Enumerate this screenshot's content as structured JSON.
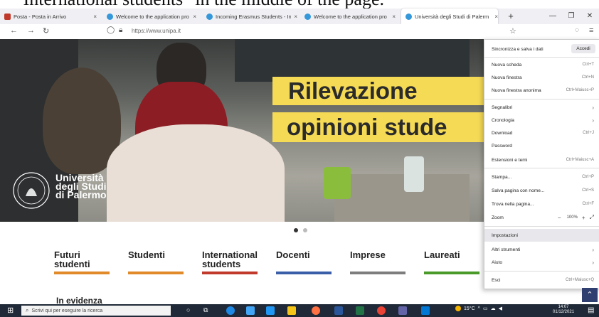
{
  "caption": "\"International students\" in the middle of the page.",
  "browser": {
    "tabs": [
      {
        "title": "Posta - Posta in Arrivo",
        "favicon_color": "#c0392b"
      },
      {
        "title": "Welcome to the application pro",
        "favicon_color": "#3498db"
      },
      {
        "title": "Incoming Erasmus Students - In",
        "favicon_color": "#3498db"
      },
      {
        "title": "Welcome to the application pro",
        "favicon_color": "#3498db"
      },
      {
        "title": "Università degli Studi di Palerm",
        "favicon_color": "#3498db"
      }
    ],
    "new_tab": "+",
    "close_glyph": "×",
    "url": "https://www.unipa.it"
  },
  "hero": {
    "headline_line1": "Rilevazione",
    "headline_line2": "opinioni stude",
    "logo_line1": "Università",
    "logo_line2": "degli Studi",
    "logo_line3": "di Palermo"
  },
  "categories": [
    {
      "label": "Futuri studenti",
      "color": "#e18a2a"
    },
    {
      "label": "Studenti",
      "color": "#e18a2a"
    },
    {
      "label": "International students",
      "color": "#c0392b"
    },
    {
      "label": "Docenti",
      "color": "#3a5fa8"
    },
    {
      "label": "Imprese",
      "color": "#7d7d7d"
    },
    {
      "label": "Laureati",
      "color": "#4a9a2a"
    }
  ],
  "section_title": "In evidenza",
  "menu": {
    "sync_label": "Sincronizza e salva i dati",
    "signin_label": "Accedi",
    "items": [
      {
        "label": "Nuova scheda",
        "shortcut": "Ctrl+T"
      },
      {
        "label": "Nuova finestra",
        "shortcut": "Ctrl+N"
      },
      {
        "label": "Nuova finestra anonima",
        "shortcut": "Ctrl+Maiusc+P"
      },
      {
        "label": "Segnalibri",
        "shortcut": ">"
      },
      {
        "label": "Cronologia",
        "shortcut": ">"
      },
      {
        "label": "Download",
        "shortcut": "Ctrl+J"
      },
      {
        "label": "Password",
        "shortcut": ""
      },
      {
        "label": "Estensioni e temi",
        "shortcut": "Ctrl+Maiusc+A"
      },
      {
        "label": "Stampa...",
        "shortcut": "Ctrl+P"
      },
      {
        "label": "Salva pagina con nome...",
        "shortcut": "Ctrl+S"
      },
      {
        "label": "Trova nella pagina...",
        "shortcut": "Ctrl+F"
      },
      {
        "label": "Zoom",
        "shortcut": ""
      },
      {
        "label": "Impostazioni",
        "shortcut": ""
      },
      {
        "label": "Altri strumenti",
        "shortcut": ">"
      },
      {
        "label": "Aiuto",
        "shortcut": ">"
      },
      {
        "label": "Esci",
        "shortcut": "Ctrl+Maiusc+Q"
      }
    ],
    "zoom_minus": "−",
    "zoom_value": "100%",
    "zoom_plus": "+",
    "fullscreen": "⤢"
  },
  "taskbar": {
    "search_placeholder": "Scrivi qui per eseguire la ricerca",
    "weather": "15°C",
    "time": "14:07",
    "date": "01/12/2021"
  },
  "colors": {
    "accent_yellow": "#f5da55",
    "taskbar": "#1f2937",
    "nav_arrow_bg": "#2f3f6f"
  }
}
